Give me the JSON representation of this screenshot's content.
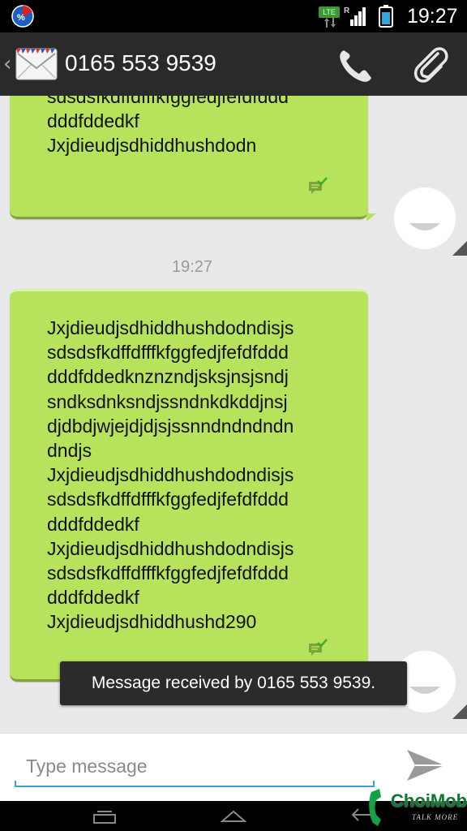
{
  "status_bar": {
    "app_icon": "pie-percent-icon",
    "network_type": "LTE",
    "roaming_label": "R",
    "time": "19:27"
  },
  "action_bar": {
    "title": "0165 553 9539",
    "icons": [
      "back-chevron-icon",
      "envelope-icon",
      "phone-icon",
      "paperclip-icon"
    ]
  },
  "conversation": {
    "messages": [
      {
        "text": "sdsdsfkdffdfffkfggfedjfefdfddd\ndddfddedkf\nJxjdieudjsdhiddhushdodn",
        "status_icon": "delivered-check-icon"
      },
      {
        "text": "Jxjdieudjsdhiddhushdodndisjs\nsdsdsfkdffdfffkfggfedjfefdfddd\ndddfddedknznzndjsksjnsjsndj\nsndksdnksndjssndnkdkddjnsj\ndjdbdjwjejdjdjsjssnndndndndn\ndndjs\nJxjdieudjsdhiddhushdodndisjs\nsdsdsfkdffdfffkfggfedjfefdfddd\ndddfddedkf\nJxjdieudjsdhiddhushdodndisjs\nsdsdsfkdffdfffkfggfedjfefdfddd\ndddfddedkf\nJxjdieudjsdhiddhushd290",
        "status_icon": "delivered-check-icon"
      }
    ],
    "timestamp": "19:27",
    "toast": "Message received by 0165 553 9539."
  },
  "composer": {
    "placeholder": "Type message",
    "value": "",
    "send_icon": "send-icon"
  },
  "nav_bar": {
    "icons": [
      "recents-icon",
      "home-icon",
      "back-icon"
    ]
  },
  "watermark": {
    "text": "ChoiMobile",
    "tagline": "TALK MORE"
  },
  "colors": {
    "bubble": "#b6e35b",
    "accent": "#34a5db",
    "action_bar": "#2a2a2a"
  }
}
